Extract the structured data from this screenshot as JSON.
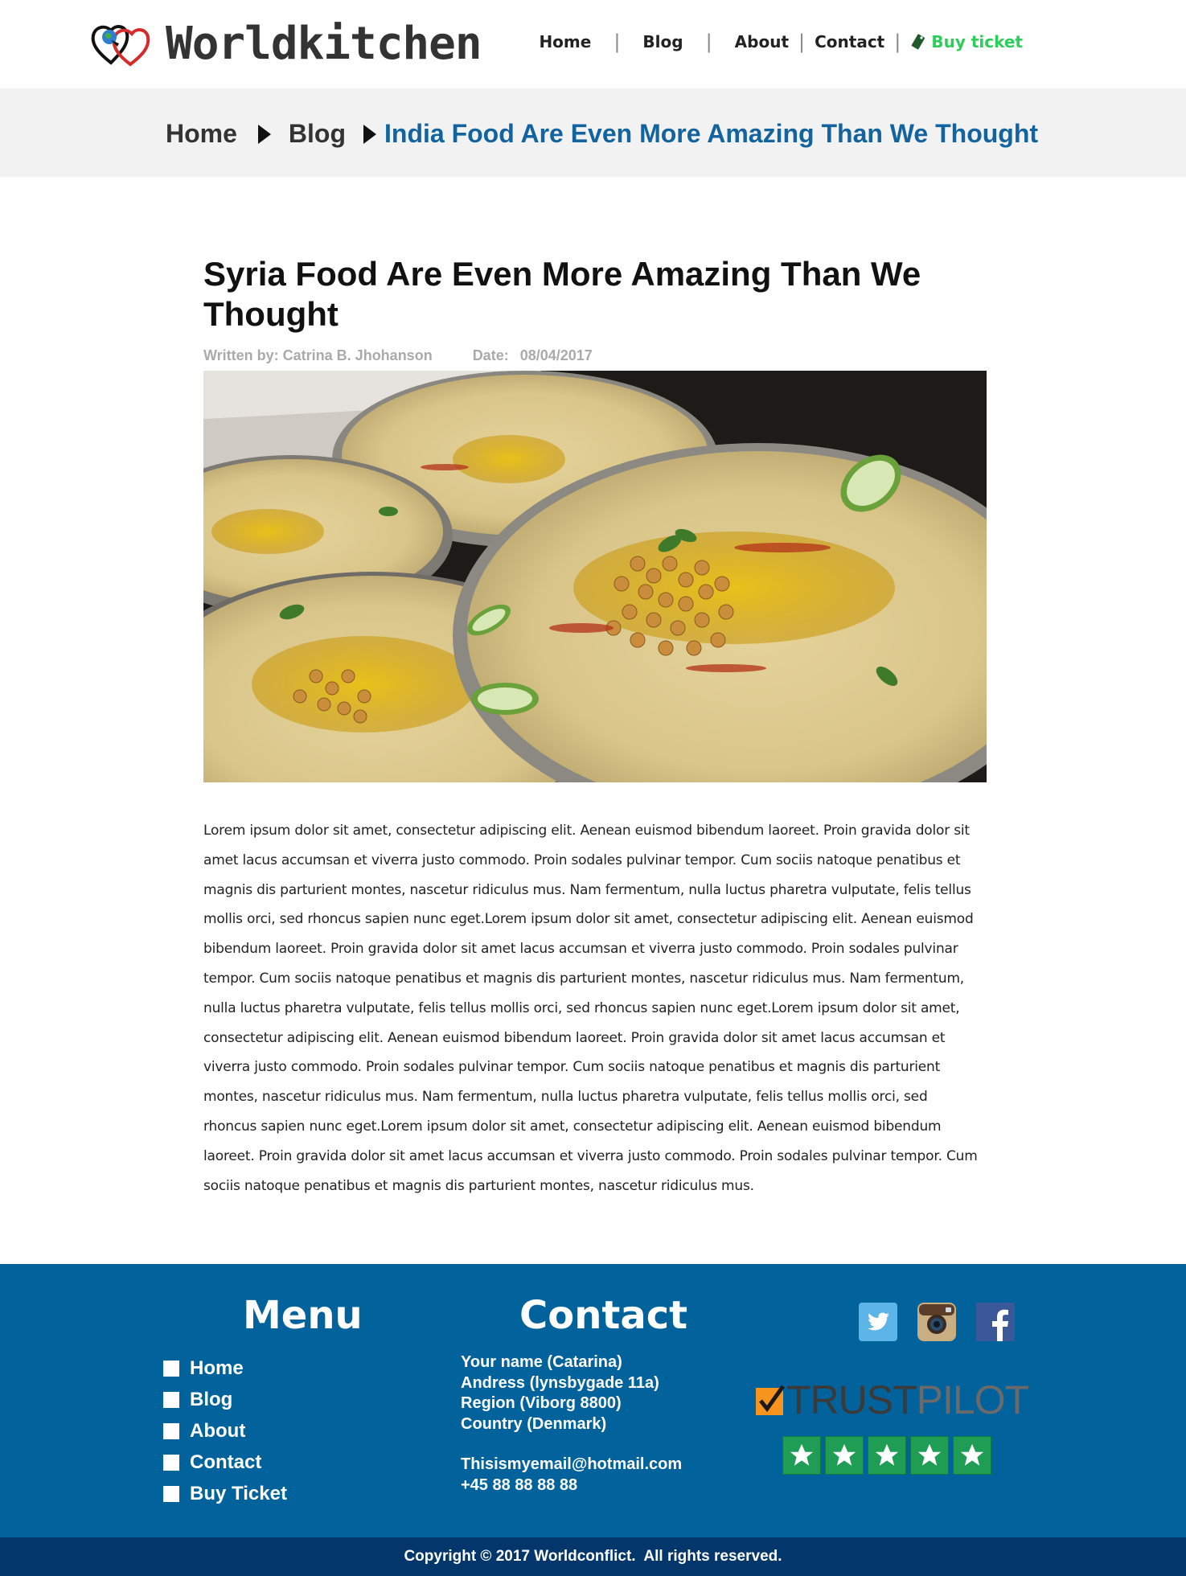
{
  "header": {
    "logo_text": "Worldkitchen",
    "nav": {
      "home": "Home",
      "blog": "Blog",
      "about": "About",
      "contact": "Contact",
      "buy_ticket": "Buy ticket"
    },
    "separator": "|"
  },
  "breadcrumb": {
    "items": [
      "Home",
      "Blog"
    ],
    "current": "India Food Are Even More Amazing Than We Thought"
  },
  "article": {
    "title": "Syria Food Are Even More Amazing Than We Thought",
    "author_label": "Written by: Catrina B. Jhohanson",
    "date_label": "Date:",
    "date": "08/04/2017",
    "body": "Lorem ipsum dolor sit amet, consectetur adipiscing elit. Aenean euismod bibendum laoreet. Proin gravida dolor sit amet lacus accumsan et viverra justo commodo. Proin sodales pulvinar tempor. Cum sociis natoque penatibus et magnis dis parturient montes, nascetur ridiculus mus. Nam fermentum, nulla luctus pharetra vulputate, felis tellus mollis orci, sed rhoncus sapien nunc eget.Lorem ipsum dolor sit amet, consectetur adipiscing elit. Aenean euismod bibendum laoreet. Proin gravida dolor sit amet lacus accumsan et viverra justo commodo. Proin sodales pulvinar tempor. Cum sociis natoque penatibus et magnis dis parturient montes, nascetur ridiculus mus. Nam fermentum, nulla luctus pharetra vulputate, felis tellus mollis orci, sed rhoncus sapien nunc eget.Lorem ipsum dolor sit amet, consectetur adipiscing elit. Aenean euismod bibendum laoreet. Proin gravida dolor sit amet lacus accumsan et viverra justo commodo. Proin sodales pulvinar tempor. Cum sociis natoque penatibus et magnis dis parturient montes, nascetur ridiculus mus. Nam fermentum, nulla luctus pharetra vulputate, felis tellus mollis orci, sed rhoncus sapien nunc eget.Lorem ipsum dolor sit amet, consectetur adipiscing elit. Aenean euismod bibendum laoreet. Proin gravida dolor sit amet lacus accumsan et viverra justo commodo. Proin sodales pulvinar tempor. Cum sociis natoque penatibus et magnis dis parturient montes, nascetur ridiculus mus."
  },
  "footer": {
    "menu_title": "Menu",
    "menu_items": [
      "Home",
      "Blog",
      "About",
      "Contact",
      "Buy Ticket"
    ],
    "contact_title": "Contact",
    "contact_lines": [
      "Your name (Catarina)",
      "Andress (lynsbygade 11a)",
      "Region (Viborg 8800)",
      "Country (Denmark)"
    ],
    "email": "Thisismyemail@hotmail.com",
    "phone": "+45 88 88 88 88",
    "social_icons": [
      "twitter-icon",
      "instagram-icon",
      "facebook-icon"
    ],
    "trustpilot": {
      "word1": "TRUST",
      "word2": "PILOT",
      "stars": 5
    },
    "copyright": "Copyright © 2017 Worldconflict.  All rights reserved."
  },
  "colors": {
    "footer_bg": "#01629c",
    "copyright_bg": "#03376b",
    "breadcrumb_current": "#13639e",
    "buy_ticket": "#2ecc5a",
    "star_green": "#1f9d55"
  }
}
